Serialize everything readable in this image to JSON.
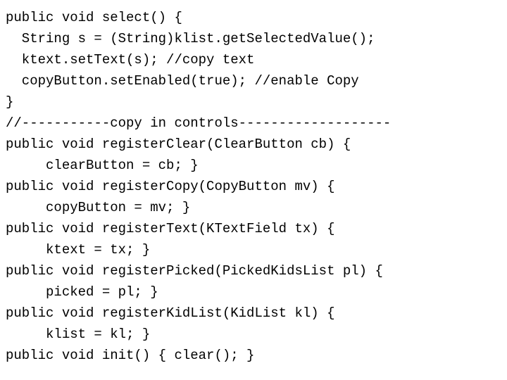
{
  "code": {
    "lines": [
      "public void select() {",
      "  String s = (String)klist.getSelectedValue();",
      "  ktext.setText(s); //copy text",
      "  copyButton.setEnabled(true); //enable Copy",
      "}",
      "//-----------copy in controls-------------------",
      "public void registerClear(ClearButton cb) {",
      "     clearButton = cb; }",
      "public void registerCopy(CopyButton mv) {",
      "     copyButton = mv; }",
      "public void registerText(KTextField tx) {",
      "     ktext = tx; }",
      "public void registerPicked(PickedKidsList pl) {",
      "     picked = pl; }",
      "public void registerKidList(KidList kl) {",
      "     klist = kl; }",
      "public void init() { clear(); }"
    ]
  }
}
